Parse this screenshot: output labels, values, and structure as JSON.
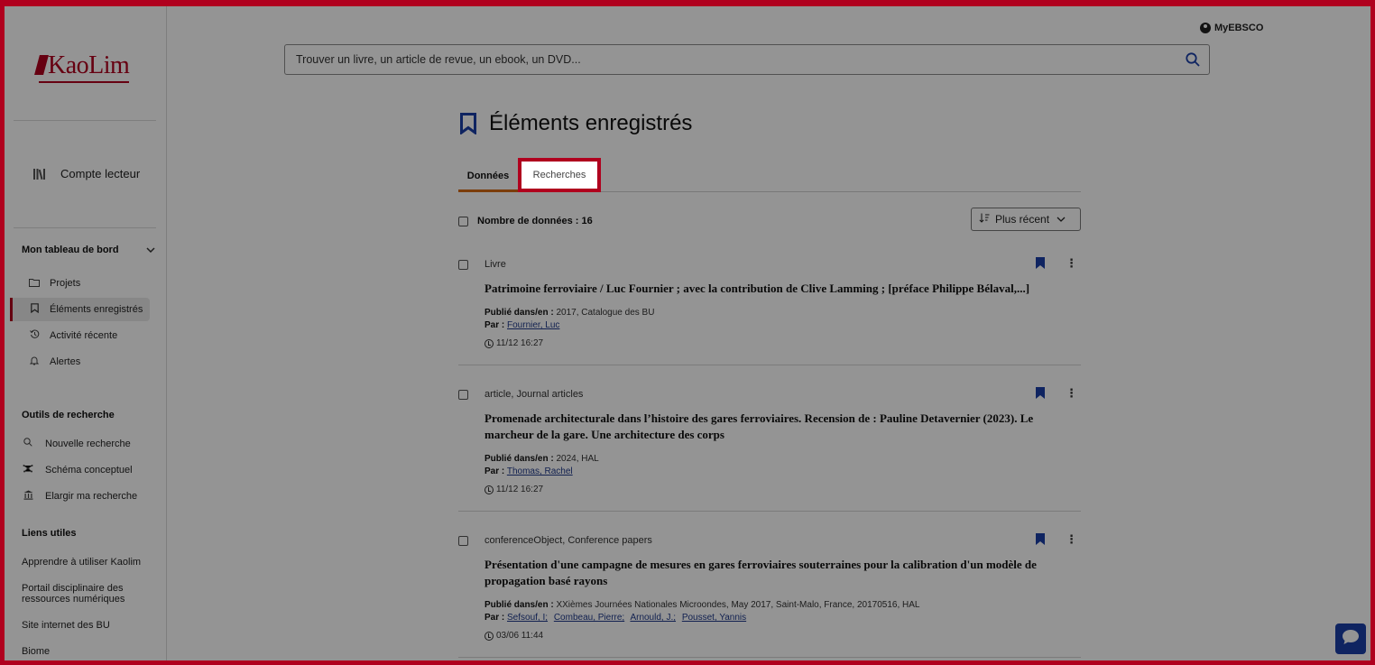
{
  "brand": {
    "logo_text": "KaoLim",
    "color": "#b0001e"
  },
  "header": {
    "account_label": "MyEBSCO"
  },
  "search": {
    "placeholder": "Trouver un livre, un article de revue, un ebook, un DVD..."
  },
  "sidebar": {
    "account_label": "Compte lecteur",
    "dashboard_title": "Mon tableau de bord",
    "dashboard_items": [
      {
        "label": "Projets",
        "icon": "folder-icon"
      },
      {
        "label": "Éléments enregistrés",
        "icon": "bookmark-icon",
        "active": true
      },
      {
        "label": "Activité récente",
        "icon": "history-icon"
      },
      {
        "label": "Alertes",
        "icon": "bell-icon"
      }
    ],
    "tools_title": "Outils de recherche",
    "tools_items": [
      {
        "label": "Nouvelle recherche",
        "icon": "search-icon"
      },
      {
        "label": "Schéma conceptuel",
        "icon": "concept-map-icon"
      },
      {
        "label": "Elargir ma recherche",
        "icon": "library-icon"
      }
    ],
    "links_title": "Liens utiles",
    "links_items": [
      "Apprendre à utiliser Kaolim",
      "Portail disciplinaire des ressources numériques",
      "Site internet des BU",
      "Biome"
    ]
  },
  "main": {
    "title": "Éléments enregistrés",
    "tabs": [
      "Données",
      "Recherches"
    ],
    "count_label": "Nombre de données : 16",
    "sort_label": "Plus récent",
    "published_label": "Publié dans/en :",
    "by_label": "Par :",
    "results": [
      {
        "type": "Livre",
        "title": "Patrimoine ferroviaire / Luc Fournier ; avec la contribution de Clive Lamming ; [préface Philippe Bélaval,...]",
        "published": "2017, Catalogue des BU",
        "authors": [
          "Fournier, Luc"
        ],
        "time": "11/12 16:27"
      },
      {
        "type": "article, Journal articles",
        "title": "Promenade architecturale dans l’histoire des gares ferroviaires. Recension de : Pauline Detavernier (2023). Le marcheur de la gare. Une architecture des corps",
        "published": "2024, HAL",
        "authors": [
          "Thomas, Rachel"
        ],
        "time": "11/12 16:27"
      },
      {
        "type": "conferenceObject, Conference papers",
        "title": "Présentation d'une campagne de mesures en gares ferroviaires souterraines pour la calibration d'un modèle de propagation basé rayons",
        "published": "XXièmes Journées Nationales Microondes, May 2017, Saint-Malo, France, 20170516, HAL",
        "authors": [
          "Sefsouf, I;",
          "Combeau, Pierre;",
          "Arnould, J.;",
          "Pousset, Yannis"
        ],
        "time": "03/06 11:44"
      }
    ]
  },
  "colors": {
    "accent": "#d46a13",
    "primary": "#1a3fa8",
    "highlight": "#b0001e"
  }
}
